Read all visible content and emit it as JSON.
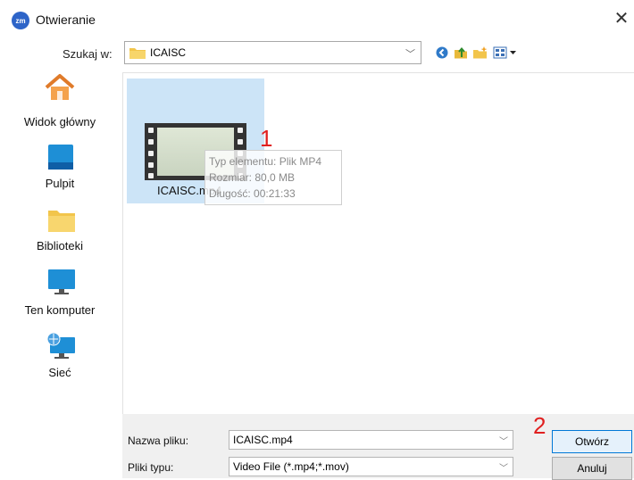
{
  "window": {
    "title": "Otwieranie",
    "app_icon_text": "zm",
    "close_glyph": "✕"
  },
  "lookin": {
    "label": "Szukaj w:",
    "folder": "ICAISC"
  },
  "places": [
    {
      "label": "Widok główny",
      "icon": "home-icon"
    },
    {
      "label": "Pulpit",
      "icon": "desktop-icon"
    },
    {
      "label": "Biblioteki",
      "icon": "libraries-icon"
    },
    {
      "label": "Ten komputer",
      "icon": "computer-icon"
    },
    {
      "label": "Sieć",
      "icon": "network-icon"
    }
  ],
  "file": {
    "name": "ICAISC.mp4",
    "tooltip": {
      "type": "Typ elementu: Plik MP4",
      "size": "Rozmiar: 80,0 MB",
      "length": "Długość: 00:21:33"
    }
  },
  "markers": {
    "one": "1",
    "two": "2"
  },
  "filename": {
    "label": "Nazwa pliku:",
    "value": "ICAISC.mp4"
  },
  "filetype": {
    "label": "Pliki typu:",
    "value": "Video File (*.mp4;*.mov)"
  },
  "buttons": {
    "open": "Otwórz",
    "cancel": "Anuluj"
  },
  "colors": {
    "selection": "#cce4f7",
    "accent": "#0078d7",
    "marker": "#e02020"
  }
}
